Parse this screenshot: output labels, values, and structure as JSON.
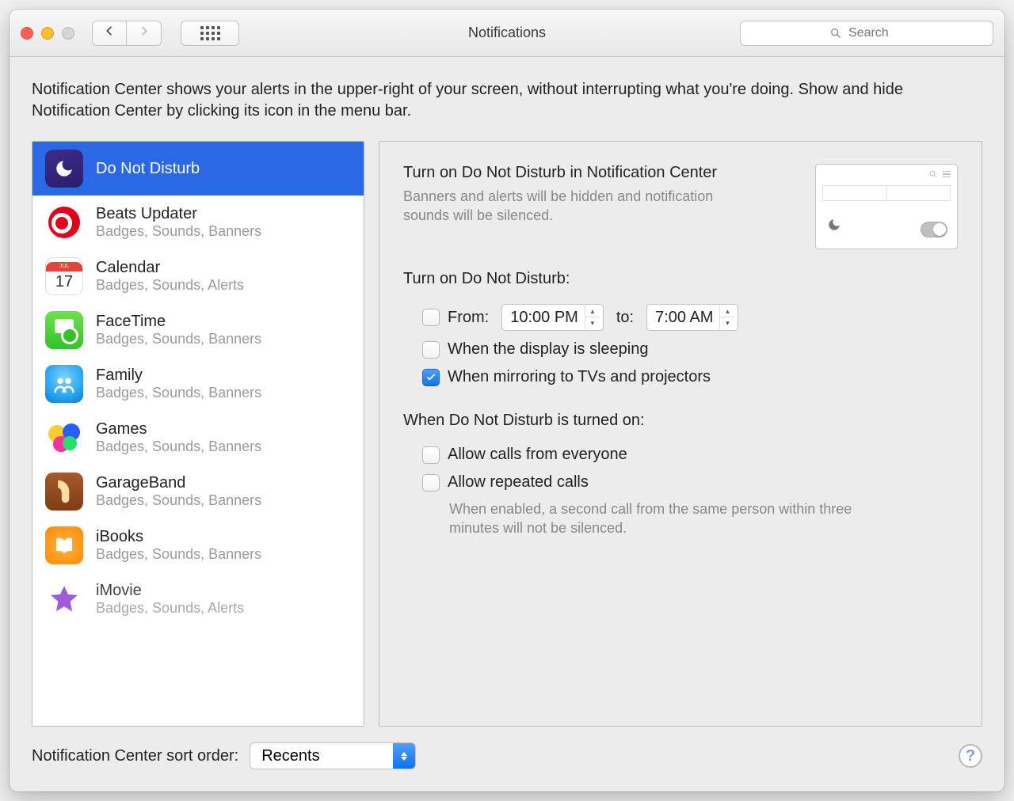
{
  "window": {
    "title": "Notifications"
  },
  "search": {
    "placeholder": "Search"
  },
  "intro": "Notification Center shows your alerts in the upper-right of your screen, without interrupting what you're doing. Show and hide Notification Center by clicking its icon in the menu bar.",
  "sidebar": {
    "items": [
      {
        "name": "Do Not Disturb",
        "sub": "",
        "icon": "dnd",
        "selected": true
      },
      {
        "name": "Beats Updater",
        "sub": "Badges, Sounds, Banners",
        "icon": "beats",
        "selected": false
      },
      {
        "name": "Calendar",
        "sub": "Badges, Sounds, Alerts",
        "icon": "calendar",
        "selected": false
      },
      {
        "name": "FaceTime",
        "sub": "Badges, Sounds, Banners",
        "icon": "facetime",
        "selected": false
      },
      {
        "name": "Family",
        "sub": "Badges, Sounds, Banners",
        "icon": "family",
        "selected": false
      },
      {
        "name": "Games",
        "sub": "Badges, Sounds, Banners",
        "icon": "games",
        "selected": false
      },
      {
        "name": "GarageBand",
        "sub": "Badges, Sounds, Banners",
        "icon": "gb",
        "selected": false
      },
      {
        "name": "iBooks",
        "sub": "Badges, Sounds, Banners",
        "icon": "ibooks",
        "selected": false
      },
      {
        "name": "iMovie",
        "sub": "Badges, Sounds, Alerts",
        "icon": "imovie",
        "selected": false
      }
    ]
  },
  "calendar_icon": {
    "month": "JUL",
    "day": "17"
  },
  "detail": {
    "title": "Turn on Do Not Disturb in Notification Center",
    "sub": "Banners and alerts will be hidden and notification sounds will be silenced.",
    "section1": {
      "heading": "Turn on Do Not Disturb:",
      "from_label": "From:",
      "from_value": "10:00 PM",
      "to_label": "to:",
      "to_value": "7:00 AM",
      "from_checked": false,
      "sleeping_label": "When the display is sleeping",
      "sleeping_checked": false,
      "mirror_label": "When mirroring to TVs and projectors",
      "mirror_checked": true
    },
    "section2": {
      "heading": "When Do Not Disturb is turned on:",
      "allow_everyone_label": "Allow calls from everyone",
      "allow_everyone_checked": false,
      "allow_repeated_label": "Allow repeated calls",
      "allow_repeated_checked": false,
      "repeated_hint": "When enabled, a second call from the same person within three minutes will not be silenced."
    }
  },
  "footer": {
    "label": "Notification Center sort order:",
    "value": "Recents"
  }
}
